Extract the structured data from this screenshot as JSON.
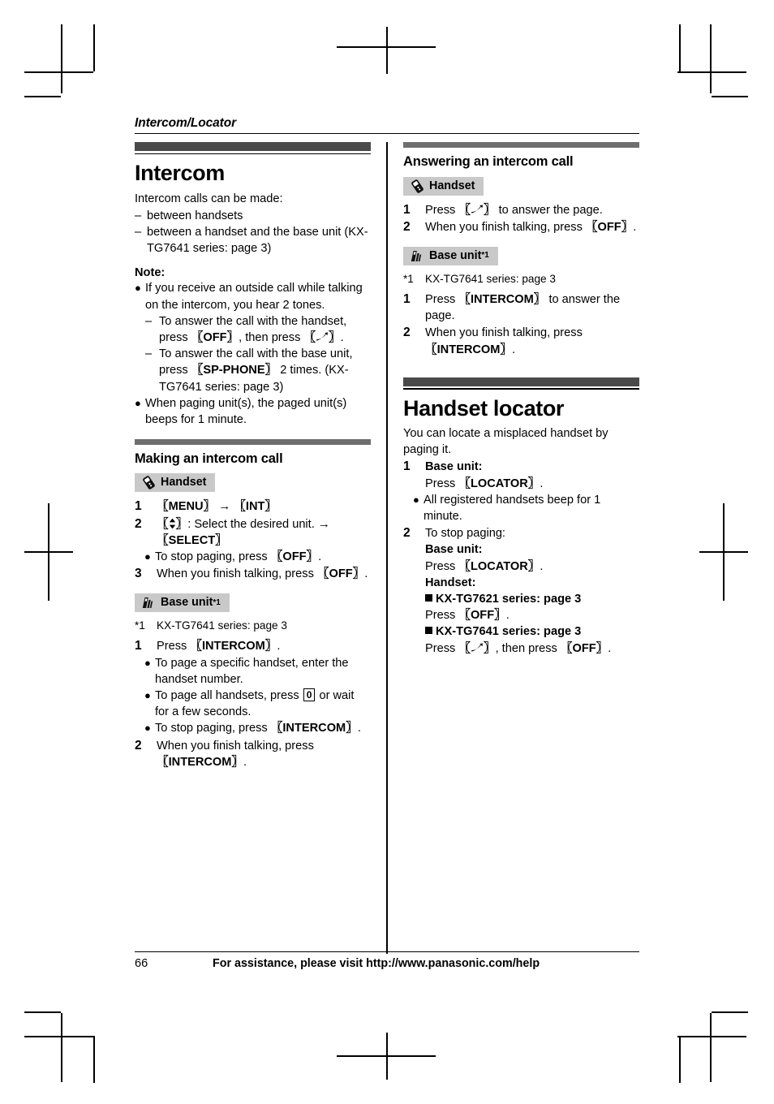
{
  "running_head": "Intercom/Locator",
  "left_column": {
    "chapter_title": "Intercom",
    "intro": "Intercom calls can be made:",
    "intro_items": [
      "between handsets",
      "between a handset and the base unit (KX-TG7641 series: page 3)"
    ],
    "note_label": "Note:",
    "notes": [
      {
        "text": "If you receive an outside call while talking on the intercom, you hear 2 tones.",
        "sub": [
          "To answer the call with the handset, press {OFF}, then press {HOOK}.",
          "To answer the call with the base unit, press {SP-PHONE} 2 times. (KX-TG7641 series: page 3)"
        ]
      },
      {
        "text": "When paging unit(s), the paged unit(s) beeps for 1 minute.",
        "sub": []
      }
    ],
    "section_title": "Making an intercom call",
    "handset_badge": "Handset",
    "handset_steps": [
      {
        "n": "1",
        "text": "{MENU} -> {INT}",
        "bullets": []
      },
      {
        "n": "2",
        "text": "{NAV}: Select the desired unit. -> {SELECT}",
        "bullets": [
          "To stop paging, press {OFF}."
        ]
      },
      {
        "n": "3",
        "text": "When you finish talking, press {OFF}.",
        "bullets": []
      }
    ],
    "base_badge": "Base unit",
    "base_badge_sup": "*1",
    "footnote_mark": "*1",
    "footnote_text": "KX-TG7641 series: page 3",
    "base_steps": [
      {
        "n": "1",
        "text": "Press {INTERCOM}.",
        "bullets": [
          "To page a specific handset, enter the handset number.",
          "To page all handsets, press [0] or wait for a few seconds.",
          "To stop paging, press {INTERCOM}."
        ]
      },
      {
        "n": "2",
        "text": "When you finish talking, press {INTERCOM}.",
        "bullets": []
      }
    ]
  },
  "right_column": {
    "section_title": "Answering an intercom call",
    "handset_badge": "Handset",
    "handset_steps": [
      {
        "n": "1",
        "text": "Press {HOOK} to answer the page."
      },
      {
        "n": "2",
        "text": "When you finish talking, press {OFF}."
      }
    ],
    "base_badge": "Base unit",
    "base_badge_sup": "*1",
    "footnote_mark": "*1",
    "footnote_text": "KX-TG7641 series: page 3",
    "base_steps": [
      {
        "n": "1",
        "text": "Press {INTERCOM} to answer the page."
      },
      {
        "n": "2",
        "text": "When you finish talking, press {INTERCOM}."
      }
    ],
    "chapter_title": "Handset locator",
    "locator_intro": "You can locate a misplaced handset by paging it.",
    "locator_steps": [
      {
        "n": "1",
        "lines": [
          "BOLD:Base unit:",
          "Press {LOCATOR}."
        ],
        "bullets": [
          "All registered handsets beep for 1 minute."
        ]
      },
      {
        "n": "2",
        "lines": [
          "To stop paging:",
          "BOLD:Base unit:",
          "Press {LOCATOR}.",
          "BOLD:Handset:",
          "SQ:KX-TG7621 series: page 3",
          "Press {OFF}.",
          "SQ:KX-TG7641 series: page 3",
          "Press {HOOK}, then press {OFF}."
        ],
        "bullets": []
      }
    ]
  },
  "footer": {
    "page_number": "66",
    "assistance": "For assistance, please visit http://www.panasonic.com/help"
  },
  "colors": {
    "chapter_bar": "#4a4a4a",
    "section_bar": "#6e6e6e",
    "badge_bg": "#c9c9c9",
    "text": "#000000",
    "page_bg": "#ffffff"
  }
}
